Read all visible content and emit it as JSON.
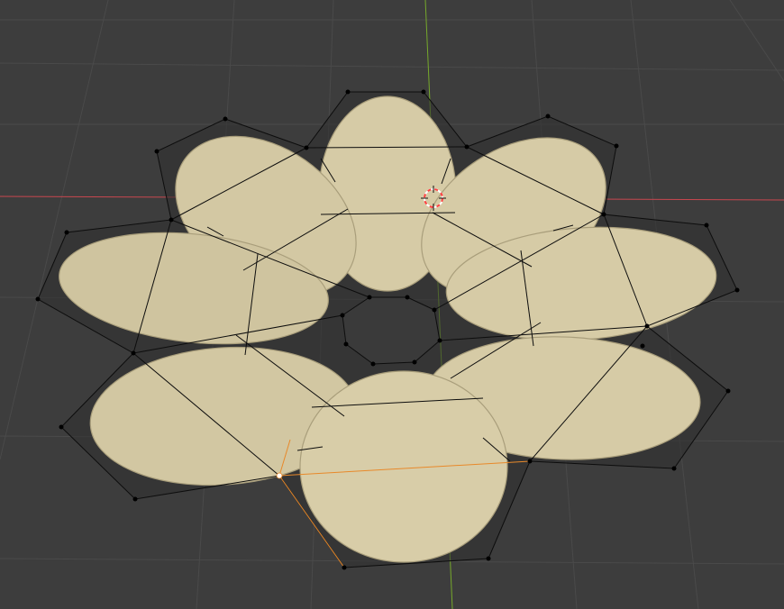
{
  "viewport": {
    "background_color": "#3d3d3d",
    "grid_color": "#4a4a4a",
    "x_axis_color": "#c8474f",
    "y_axis_color": "#76a92b"
  },
  "object": {
    "type": "curve-surface",
    "petal_count": 8,
    "surface_color": "#d6cba6",
    "surface_shadow_color": "#b9ad88"
  },
  "control_cage": {
    "edge_color": "#0d0d0d",
    "vertex_color": "#000000",
    "selected_vertex_color": "#ffffff",
    "selected_edge_color": "#e8892a"
  },
  "cursor_3d": {
    "icon": "3d-cursor-icon",
    "ring_colors": [
      "#ff4040",
      "#ffffff"
    ]
  }
}
